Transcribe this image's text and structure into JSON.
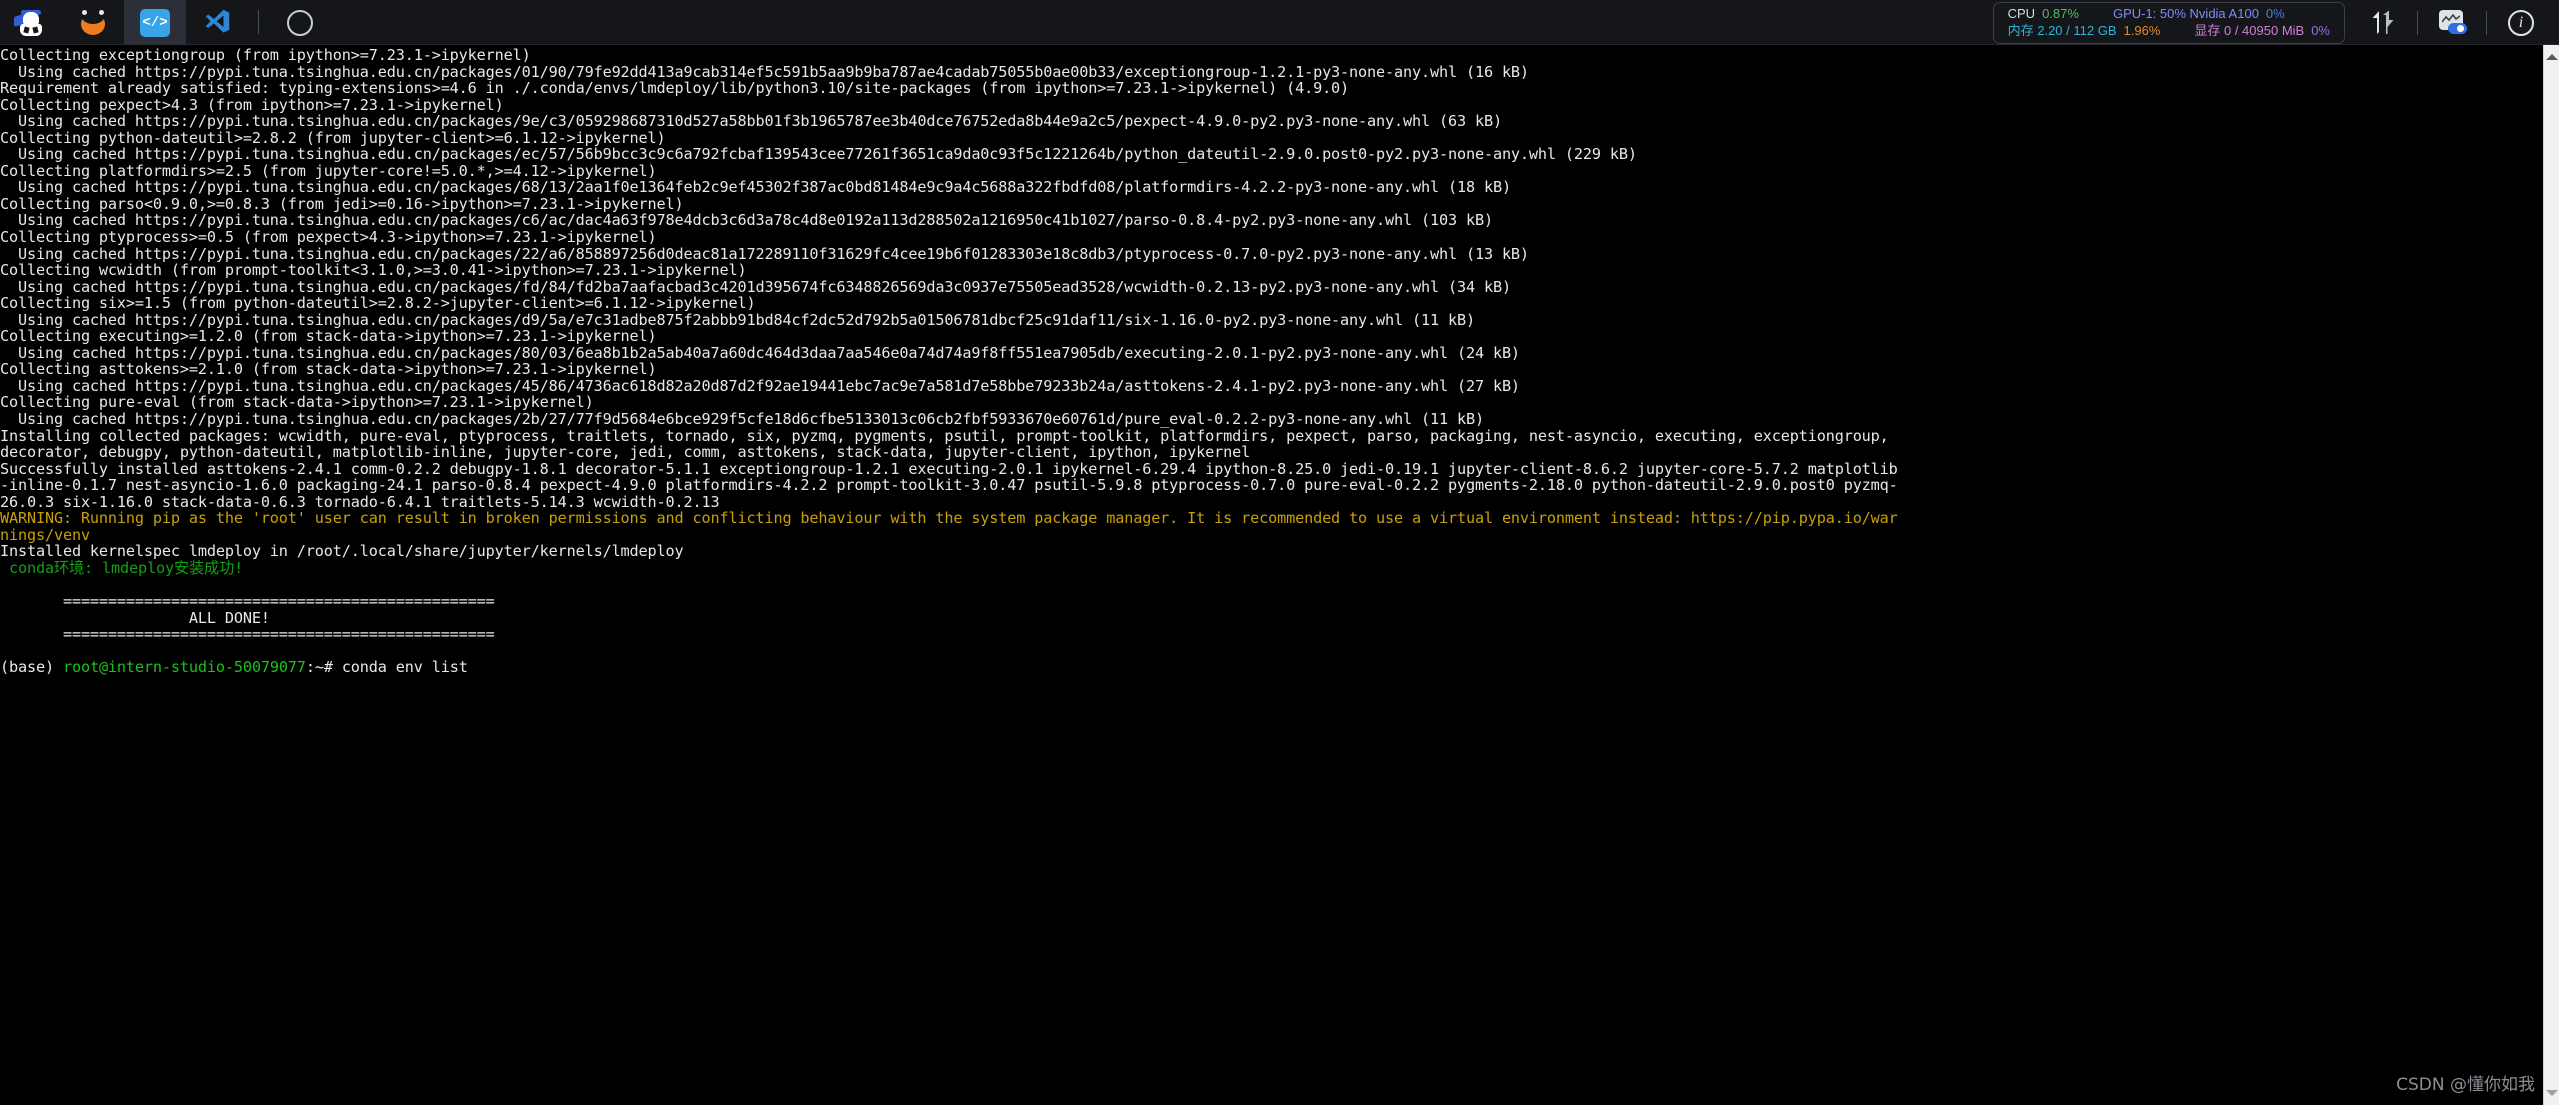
{
  "toolbar": {
    "left_items": [
      {
        "name": "intern-studio-logo",
        "icon": "robot-icon",
        "label": "InternStudio",
        "active": false
      },
      {
        "name": "conda-app",
        "icon": "conda-icon",
        "label": "Conda",
        "active": false
      },
      {
        "name": "code-editor-app",
        "icon": "code-icon",
        "label": "</>",
        "active": true
      },
      {
        "name": "vscode-app",
        "icon": "vscode-icon",
        "label": "VS Code",
        "active": false
      },
      {
        "name": "browser-app",
        "icon": "compass-icon",
        "label": "Browser",
        "active": false
      }
    ],
    "stats": {
      "cpu_label": "CPU",
      "cpu_value": "0.87%",
      "memory_label": "内存 2.20 / 112 GB",
      "memory_value": "1.96%",
      "gpu_label": "GPU-1: 50% Nvidia A100",
      "gpu_value": "0%",
      "vram_label": "显存 0 / 40950 MiB",
      "vram_value": "0%"
    },
    "right_items": [
      {
        "name": "network-traffic-icon",
        "label": "Network"
      },
      {
        "name": "monitor-toggle-icon",
        "label": "Monitor"
      },
      {
        "name": "info-icon",
        "label": "Info"
      }
    ],
    "colors": {
      "cpu": "#4fbf6a",
      "memory": "#e08a28",
      "gpu": "#3f7fe8",
      "vram": "#9b6fe0",
      "accent_blue": "#38a3e8",
      "toolbar_bg": "#14161a"
    }
  },
  "terminal": {
    "lines": [
      {
        "c": "white",
        "t": "Collecting exceptiongroup (from ipython>=7.23.1->ipykernel)"
      },
      {
        "c": "white",
        "t": "  Using cached https://pypi.tuna.tsinghua.edu.cn/packages/01/90/79fe92dd413a9cab314ef5c591b5aa9b9ba787ae4cadab75055b0ae00b33/exceptiongroup-1.2.1-py3-none-any.whl (16 kB)"
      },
      {
        "c": "white",
        "t": "Requirement already satisfied: typing-extensions>=4.6 in ./.conda/envs/lmdeploy/lib/python3.10/site-packages (from ipython>=7.23.1->ipykernel) (4.9.0)"
      },
      {
        "c": "white",
        "t": "Collecting pexpect>4.3 (from ipython>=7.23.1->ipykernel)"
      },
      {
        "c": "white",
        "t": "  Using cached https://pypi.tuna.tsinghua.edu.cn/packages/9e/c3/059298687310d527a58bb01f3b1965787ee3b40dce76752eda8b44e9a2c5/pexpect-4.9.0-py2.py3-none-any.whl (63 kB)"
      },
      {
        "c": "white",
        "t": "Collecting python-dateutil>=2.8.2 (from jupyter-client>=6.1.12->ipykernel)"
      },
      {
        "c": "white",
        "t": "  Using cached https://pypi.tuna.tsinghua.edu.cn/packages/ec/57/56b9bcc3c9c6a792fcbaf139543cee77261f3651ca9da0c93f5c1221264b/python_dateutil-2.9.0.post0-py2.py3-none-any.whl (229 kB)"
      },
      {
        "c": "white",
        "t": "Collecting platformdirs>=2.5 (from jupyter-core!=5.0.*,>=4.12->ipykernel)"
      },
      {
        "c": "white",
        "t": "  Using cached https://pypi.tuna.tsinghua.edu.cn/packages/68/13/2aa1f0e1364feb2c9ef45302f387ac0bd81484e9c9a4c5688a322fbdfd08/platformdirs-4.2.2-py3-none-any.whl (18 kB)"
      },
      {
        "c": "white",
        "t": "Collecting parso<0.9.0,>=0.8.3 (from jedi>=0.16->ipython>=7.23.1->ipykernel)"
      },
      {
        "c": "white",
        "t": "  Using cached https://pypi.tuna.tsinghua.edu.cn/packages/c6/ac/dac4a63f978e4dcb3c6d3a78c4d8e0192a113d288502a1216950c41b1027/parso-0.8.4-py2.py3-none-any.whl (103 kB)"
      },
      {
        "c": "white",
        "t": "Collecting ptyprocess>=0.5 (from pexpect>4.3->ipython>=7.23.1->ipykernel)"
      },
      {
        "c": "white",
        "t": "  Using cached https://pypi.tuna.tsinghua.edu.cn/packages/22/a6/858897256d0deac81a172289110f31629fc4cee19b6f01283303e18c8db3/ptyprocess-0.7.0-py2.py3-none-any.whl (13 kB)"
      },
      {
        "c": "white",
        "t": "Collecting wcwidth (from prompt-toolkit<3.1.0,>=3.0.41->ipython>=7.23.1->ipykernel)"
      },
      {
        "c": "white",
        "t": "  Using cached https://pypi.tuna.tsinghua.edu.cn/packages/fd/84/fd2ba7aafacbad3c4201d395674fc6348826569da3c0937e75505ead3528/wcwidth-0.2.13-py2.py3-none-any.whl (34 kB)"
      },
      {
        "c": "white",
        "t": "Collecting six>=1.5 (from python-dateutil>=2.8.2->jupyter-client>=6.1.12->ipykernel)"
      },
      {
        "c": "white",
        "t": "  Using cached https://pypi.tuna.tsinghua.edu.cn/packages/d9/5a/e7c31adbe875f2abbb91bd84cf2dc52d792b5a01506781dbcf25c91daf11/six-1.16.0-py2.py3-none-any.whl (11 kB)"
      },
      {
        "c": "white",
        "t": "Collecting executing>=1.2.0 (from stack-data->ipython>=7.23.1->ipykernel)"
      },
      {
        "c": "white",
        "t": "  Using cached https://pypi.tuna.tsinghua.edu.cn/packages/80/03/6ea8b1b2a5ab40a7a60dc464d3daa7aa546e0a74d74a9f8ff551ea7905db/executing-2.0.1-py2.py3-none-any.whl (24 kB)"
      },
      {
        "c": "white",
        "t": "Collecting asttokens>=2.1.0 (from stack-data->ipython>=7.23.1->ipykernel)"
      },
      {
        "c": "white",
        "t": "  Using cached https://pypi.tuna.tsinghua.edu.cn/packages/45/86/4736ac618d82a20d87d2f92ae19441ebc7ac9e7a581d7e58bbe79233b24a/asttokens-2.4.1-py2.py3-none-any.whl (27 kB)"
      },
      {
        "c": "white",
        "t": "Collecting pure-eval (from stack-data->ipython>=7.23.1->ipykernel)"
      },
      {
        "c": "white",
        "t": "  Using cached https://pypi.tuna.tsinghua.edu.cn/packages/2b/27/77f9d5684e6bce929f5cfe18d6cfbe5133013c06cb2fbf5933670e60761d/pure_eval-0.2.2-py3-none-any.whl (11 kB)"
      },
      {
        "c": "white",
        "t": "Installing collected packages: wcwidth, pure-eval, ptyprocess, traitlets, tornado, six, pyzmq, pygments, psutil, prompt-toolkit, platformdirs, pexpect, parso, packaging, nest-asyncio, executing, exceptiongroup,"
      },
      {
        "c": "white",
        "t": "decorator, debugpy, python-dateutil, matplotlib-inline, jupyter-core, jedi, comm, asttokens, stack-data, jupyter-client, ipython, ipykernel"
      },
      {
        "c": "white",
        "t": "Successfully installed asttokens-2.4.1 comm-0.2.2 debugpy-1.8.1 decorator-5.1.1 exceptiongroup-1.2.1 executing-2.0.1 ipykernel-6.29.4 ipython-8.25.0 jedi-0.19.1 jupyter-client-8.6.2 jupyter-core-5.7.2 matplotlib"
      },
      {
        "c": "white",
        "t": "-inline-0.1.7 nest-asyncio-1.6.0 packaging-24.1 parso-0.8.4 pexpect-4.9.0 platformdirs-4.2.2 prompt-toolkit-3.0.47 psutil-5.9.8 ptyprocess-0.7.0 pure-eval-0.2.2 pygments-2.18.0 python-dateutil-2.9.0.post0 pyzmq-"
      },
      {
        "c": "white",
        "t": "26.0.3 six-1.16.0 stack-data-0.6.3 tornado-6.4.1 traitlets-5.14.3 wcwidth-0.2.13"
      },
      {
        "c": "yellow",
        "t": "WARNING: Running pip as the 'root' user can result in broken permissions and conflicting behaviour with the system package manager. It is recommended to use a virtual environment instead: https://pip.pypa.io/war"
      },
      {
        "c": "yellow",
        "t": "nings/venv"
      },
      {
        "c": "white",
        "t": "Installed kernelspec lmdeploy in /root/.local/share/jupyter/kernels/lmdeploy"
      },
      {
        "c": "green",
        "t": " conda环境: lmdeploy安装成功!"
      },
      {
        "c": "white",
        "t": ""
      },
      {
        "c": "white",
        "t": "       ================================================"
      },
      {
        "c": "white",
        "t": "                     ALL DONE!"
      },
      {
        "c": "white",
        "t": "       ================================================"
      },
      {
        "c": "white",
        "t": ""
      }
    ],
    "prompt": {
      "env": "(base) ",
      "user_host": "root@intern-studio-50079077",
      "colon": ":",
      "path": "~",
      "sigil": "# ",
      "command": "conda env list"
    },
    "cursor_line": ""
  },
  "scrollbar": {
    "up_label": "scroll up",
    "down_label": "scroll down"
  },
  "watermark": "CSDN @懂你如我"
}
